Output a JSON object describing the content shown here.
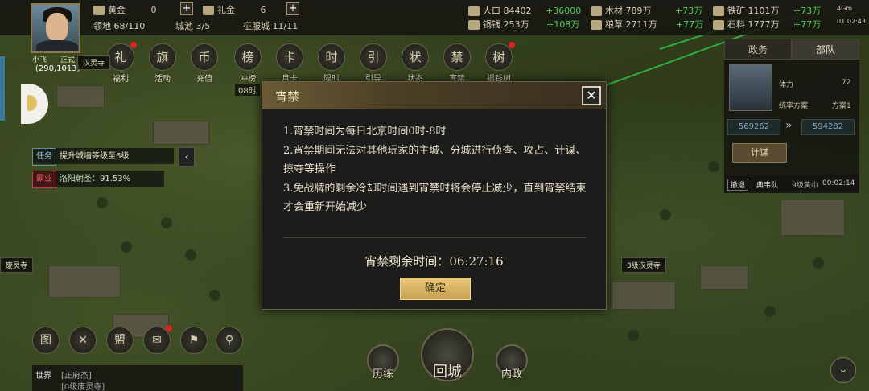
{
  "player": {
    "name": "小飞",
    "coord": "(290,1013)",
    "faction_tag": "正式"
  },
  "resources": {
    "gold_label": "黄金",
    "gold_value": "0",
    "gift_label": "礼金",
    "gift_value": "6",
    "territory": "领地 68/110",
    "cities": "城池 3/5",
    "troops": "征服城 11/11",
    "population_label": "人口",
    "population_value": "84402",
    "population_rate": "+36000",
    "copper_label": "铜钱",
    "copper_value": "253万",
    "copper_rate": "+108万",
    "wood_label": "木材",
    "wood_value": "789万",
    "wood_rate": "+73万",
    "grain_label": "粮草",
    "grain_value": "2711万",
    "grain_rate": "+77万",
    "iron_label": "铁矿",
    "iron_value": "1101万",
    "iron_rate": "+73万",
    "stone_label": "石料",
    "stone_value": "1777万",
    "stone_rate": "+77万",
    "clock": "01:02:43",
    "signal": "4Gm"
  },
  "top_icons": [
    {
      "label": "福利",
      "glyph": "礼",
      "dot": true
    },
    {
      "label": "活动",
      "glyph": "旗",
      "dot": false
    },
    {
      "label": "充值",
      "glyph": "币",
      "dot": false
    },
    {
      "label": "冲榜",
      "glyph": "榜",
      "dot": false
    },
    {
      "label": "月卡",
      "glyph": "卡",
      "dot": false
    },
    {
      "label": "限时",
      "glyph": "时",
      "dot": false
    },
    {
      "label": "引导",
      "glyph": "引",
      "dot": false
    },
    {
      "label": "状态",
      "glyph": "状",
      "dot": false
    },
    {
      "label": "宵禁",
      "glyph": "禁",
      "dot": false
    },
    {
      "label": "摇钱树",
      "glyph": "树",
      "dot": true
    }
  ],
  "timer_under_icon": "08时",
  "right_panel": {
    "tab_left": "政务",
    "tab_right": "部队",
    "stamina_label": "体力",
    "stamina_value": "72",
    "plan_label": "统率方案",
    "plan_value": "方案1",
    "power_left": "569262",
    "power_right": "594282",
    "scheme_button": "计谋",
    "march_tag": "撤退",
    "march_text": "典韦队",
    "march_status": "9级黄巾",
    "march_timer": "00:02:14"
  },
  "tasks": [
    {
      "tag": "任务",
      "text": "提升城墙等级至6级",
      "red": false
    },
    {
      "tag": "霸业",
      "text": "洛阳朝圣：91.53%",
      "red": true
    }
  ],
  "map_labels": {
    "left": "废灵寺",
    "right": "3级汉灵寺",
    "top": "汉灵寺"
  },
  "bottom_left_icons": [
    {
      "name": "map-icon",
      "glyph": "图"
    },
    {
      "name": "battle-icon",
      "glyph": "✕"
    },
    {
      "name": "handshake-icon",
      "glyph": "盟"
    },
    {
      "name": "mail-icon",
      "glyph": "✉"
    },
    {
      "name": "flag-icon",
      "glyph": "⚑"
    },
    {
      "name": "search-icon",
      "glyph": "⚲"
    }
  ],
  "chat": {
    "channel": "世界",
    "line1": "[正府杰]",
    "line2": "[0级废灵寺]"
  },
  "bottom_center": {
    "left_label": "历练",
    "center_label": "回城",
    "right_label": "内政"
  },
  "modal": {
    "title": "宵禁",
    "lines": [
      "1.宵禁时间为每日北京时间0时-8时",
      "2.宵禁期间无法对其他玩家的主城、分城进行侦查、攻占、计谋、掠夺等操作",
      "3.免战牌的剩余冷却时间遇到宵禁时将会停止减少，直到宵禁结束才会重新开始减少"
    ],
    "remain_label": "宵禁剩余时间：",
    "remain_value": "06:27:16",
    "ok_label": "确定",
    "close_glyph": "✕"
  }
}
